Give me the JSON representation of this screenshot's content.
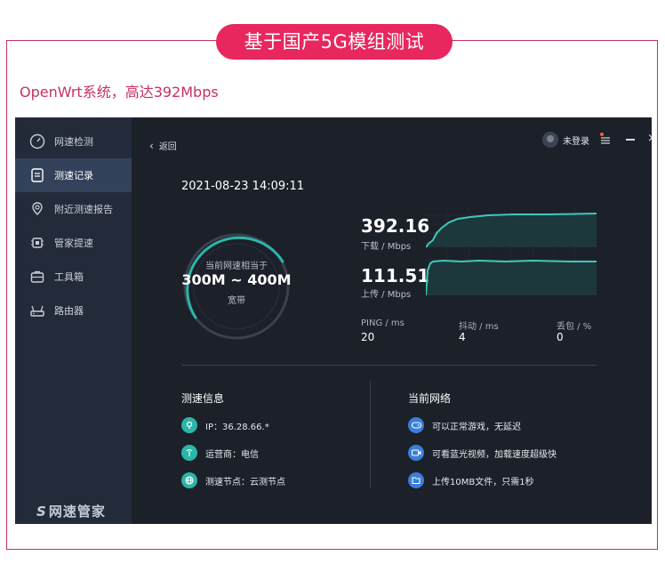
{
  "banner": {
    "title": "基于国产5G模组测试"
  },
  "subtitle": "OpenWrt系统，高达392Mbps",
  "sidebar": {
    "items": [
      {
        "label": "网速检测",
        "icon": "speedometer-icon"
      },
      {
        "label": "测速记录",
        "icon": "record-list-icon",
        "active": true
      },
      {
        "label": "附近测速报告",
        "icon": "location-icon"
      },
      {
        "label": "管家提速",
        "icon": "chip-icon"
      },
      {
        "label": "工具箱",
        "icon": "toolbox-icon"
      },
      {
        "label": "路由器",
        "icon": "router-icon"
      }
    ],
    "brand": "网速管家"
  },
  "header": {
    "back": "返回",
    "user": "未登录"
  },
  "result": {
    "timestamp": "2021-08-23 14:09:11",
    "gauge_caption": "当前网速相当于",
    "gauge_range": "300M ~ 400M",
    "gauge_unit": "宽带",
    "download_value": "392.16",
    "download_label": "下载 / Mbps",
    "upload_value": "111.51",
    "upload_label": "上传 / Mbps",
    "ping_label": "PING / ms",
    "ping_value": "20",
    "jitter_label": "抖动 / ms",
    "jitter_value": "4",
    "loss_label": "丢包 / %",
    "loss_value": "0"
  },
  "info": {
    "title": "测速信息",
    "rows": [
      "IP：36.28.66.*",
      "运营商：电信",
      "测速节点：云测节点"
    ]
  },
  "network": {
    "title": "当前网络",
    "rows": [
      "可以正常游戏，无延迟",
      "可看蓝光视频，加载速度超级快",
      "上传10MB文件，只需1秒"
    ]
  },
  "colors": {
    "accent": "#e8275f",
    "teal": "#2bb6a9",
    "blue": "#3a7fd9",
    "panel": "#1c2029",
    "sidebar": "#232b3b"
  }
}
